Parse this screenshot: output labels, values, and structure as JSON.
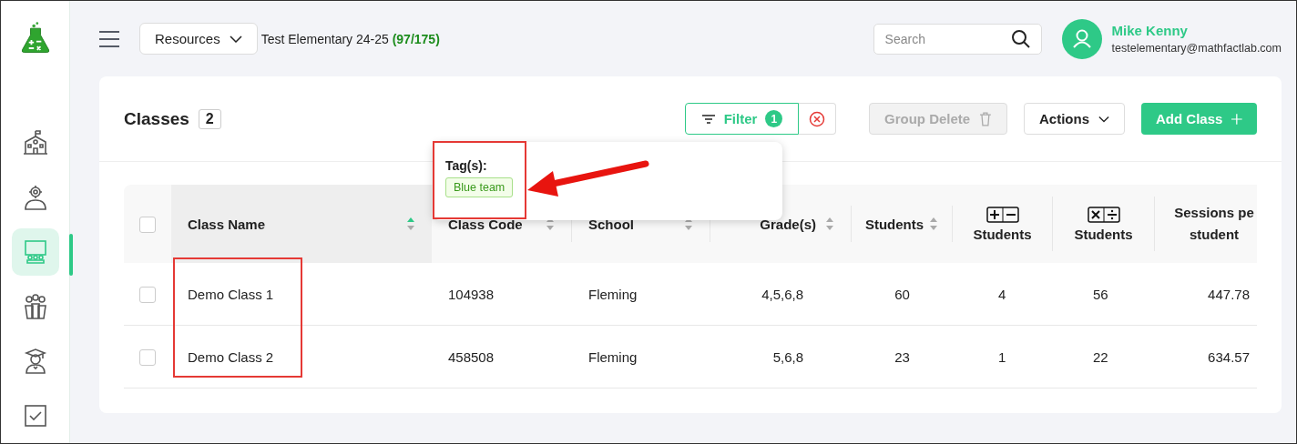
{
  "sidebar": {
    "items": [
      {
        "kind": "school",
        "selected": false
      },
      {
        "kind": "staff",
        "selected": false
      },
      {
        "kind": "classroom",
        "selected": true
      },
      {
        "kind": "group",
        "selected": false
      },
      {
        "kind": "graduate",
        "selected": false
      },
      {
        "kind": "task",
        "selected": false
      }
    ]
  },
  "header": {
    "resources_button": "Resources",
    "school": "Test Elementary 24-25",
    "count": "(97/175)",
    "search": {
      "placeholder": "Search"
    },
    "user": {
      "name": "Mike Kenny",
      "email": "testelementary@mathfactlab.com"
    }
  },
  "page": {
    "title": "Classes",
    "count": "2",
    "filter": {
      "label": "Filter",
      "badge": "1"
    },
    "buttons": [
      {
        "kind": "group-delete",
        "label": "Group Delete",
        "disabled": true
      },
      {
        "kind": "actions",
        "label": "Actions",
        "disabled": false
      },
      {
        "kind": "add",
        "label": "Add Class",
        "disabled": false
      }
    ],
    "filter_popover": {
      "heading": "Tag(s):",
      "tags": [
        "Blue team"
      ]
    }
  },
  "table": {
    "select_all": {
      "checked": false
    },
    "columns": [
      {
        "label": "Class Name",
        "kind": "sortable",
        "sorted": true
      },
      {
        "label": "Class Code",
        "kind": "sortable",
        "sorted": false
      },
      {
        "label": "School",
        "kind": "sortable",
        "sorted": false
      },
      {
        "label": "Grade(s)",
        "kind": "sortable",
        "sorted": false
      },
      {
        "label": "Students",
        "kind": "sortable",
        "sorted": false
      },
      {
        "label": "Students",
        "kind": "addsub"
      },
      {
        "label": "Students",
        "kind": "muldiv"
      },
      {
        "label": "Sessions pe student",
        "kind": "plain"
      }
    ],
    "rows": [
      {
        "checked": false,
        "cells": [
          "Demo Class 1",
          "104938",
          "Fleming",
          "4,5,6,8",
          "60",
          "4",
          "56",
          "447.78"
        ]
      },
      {
        "checked": false,
        "cells": [
          "Demo Class 2",
          "458508",
          "Fleming",
          "5,6,8",
          "23",
          "1",
          "22",
          "634.57"
        ]
      }
    ]
  }
}
